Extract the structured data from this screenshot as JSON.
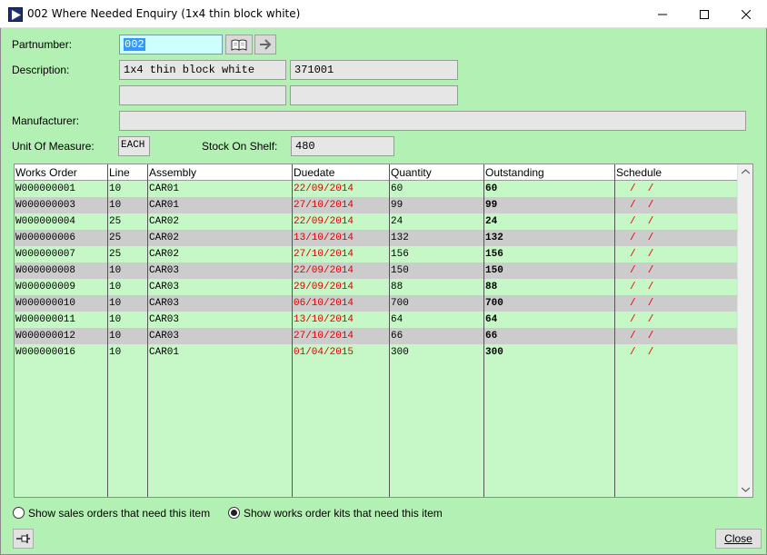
{
  "window": {
    "title": "002 Where Needed Enquiry (1x4 thin block white)",
    "controls": [
      "minimize-icon",
      "maximize-icon",
      "close-icon"
    ]
  },
  "form": {
    "partnumber_label": "Partnumber:",
    "partnumber_value": "002",
    "description_label": "Description:",
    "description_value": "1x4 thin block white",
    "description_code": "371001",
    "description_extra1": "",
    "description_extra2": "",
    "manufacturer_label": "Manufacturer:",
    "manufacturer_value": "",
    "uom_label": "Unit Of Measure:",
    "uom_value": "EACH",
    "stock_label": "Stock On Shelf:",
    "stock_value": "480",
    "lookup_icon": "book-icon",
    "go_icon": "arrow-right-icon"
  },
  "grid": {
    "columns": [
      "Works Order",
      "Line",
      "Assembly",
      "Duedate",
      "Quantity",
      "Outstanding",
      "Schedule"
    ],
    "rows": [
      {
        "wo": "W000000001",
        "line": "10",
        "asm": "CAR01",
        "due": "22/09/2014",
        "qty": "60",
        "out": "60",
        "sched": "/  /"
      },
      {
        "wo": "W000000003",
        "line": "10",
        "asm": "CAR01",
        "due": "27/10/2014",
        "qty": "99",
        "out": "99",
        "sched": "/  /"
      },
      {
        "wo": "W000000004",
        "line": "25",
        "asm": "CAR02",
        "due": "22/09/2014",
        "qty": "24",
        "out": "24",
        "sched": "/  /"
      },
      {
        "wo": "W000000006",
        "line": "25",
        "asm": "CAR02",
        "due": "13/10/2014",
        "qty": "132",
        "out": "132",
        "sched": "/  /"
      },
      {
        "wo": "W000000007",
        "line": "25",
        "asm": "CAR02",
        "due": "27/10/2014",
        "qty": "156",
        "out": "156",
        "sched": "/  /"
      },
      {
        "wo": "W000000008",
        "line": "10",
        "asm": "CAR03",
        "due": "22/09/2014",
        "qty": "150",
        "out": "150",
        "sched": "/  /"
      },
      {
        "wo": "W000000009",
        "line": "10",
        "asm": "CAR03",
        "due": "29/09/2014",
        "qty": "88",
        "out": "88",
        "sched": "/  /"
      },
      {
        "wo": "W000000010",
        "line": "10",
        "asm": "CAR03",
        "due": "06/10/2014",
        "qty": "700",
        "out": "700",
        "sched": "/  /"
      },
      {
        "wo": "W000000011",
        "line": "10",
        "asm": "CAR03",
        "due": "13/10/2014",
        "qty": "64",
        "out": "64",
        "sched": "/  /"
      },
      {
        "wo": "W000000012",
        "line": "10",
        "asm": "CAR03",
        "due": "27/10/2014",
        "qty": "66",
        "out": "66",
        "sched": "/  /"
      },
      {
        "wo": "W000000016",
        "line": "10",
        "asm": "CAR01",
        "due": "01/04/2015",
        "qty": "300",
        "out": "300",
        "sched": "/  /"
      }
    ]
  },
  "options": {
    "sales_orders_label": "Show sales orders that need this item",
    "works_order_kits_label": "Show works order kits that need this item",
    "selected": "works_order_kits"
  },
  "footer": {
    "pin_icon": "pin-icon",
    "close_label": "Close"
  },
  "colors": {
    "background": "#b3f0b3",
    "grid_background": "#c6f7c6",
    "alt_row": "#cccccc",
    "due_date": "#e00000",
    "part_field": "#ccffff"
  }
}
